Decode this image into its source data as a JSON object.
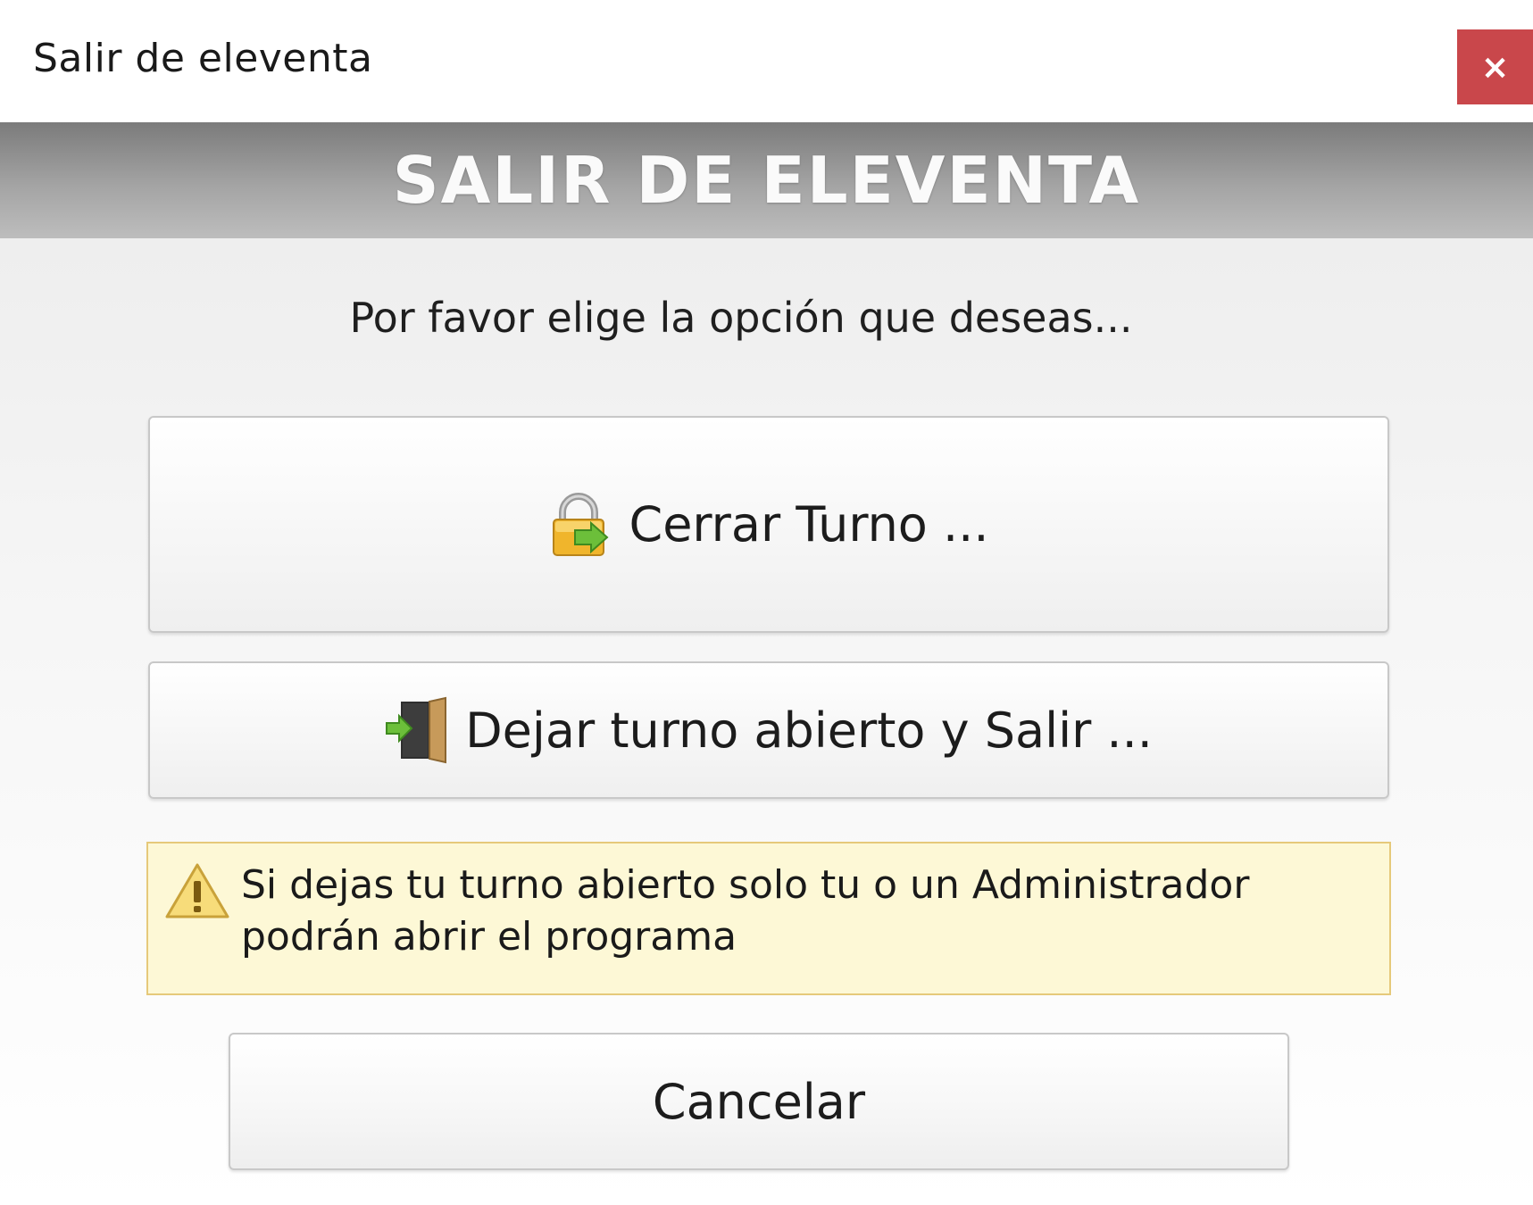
{
  "window": {
    "title": "Salir de eleventa",
    "close_label": "×"
  },
  "header": {
    "title": "SALIR DE ELEVENTA"
  },
  "main": {
    "prompt": "Por favor elige la opción que deseas...",
    "options": [
      {
        "label": "Cerrar Turno ...",
        "icon": "lock-exit-icon"
      },
      {
        "label": "Dejar turno abierto y Salir ...",
        "icon": "door-exit-icon"
      }
    ],
    "warning": {
      "icon": "warning-icon",
      "text": "Si dejas tu turno abierto solo tu o un Administrador podrán abrir el programa"
    },
    "cancel_label": "Cancelar"
  },
  "colors": {
    "close_button": "#c9474b",
    "header_band": "#9a9a9a",
    "warning_background": "#fdf8d6",
    "warning_border": "#e6c97a"
  }
}
